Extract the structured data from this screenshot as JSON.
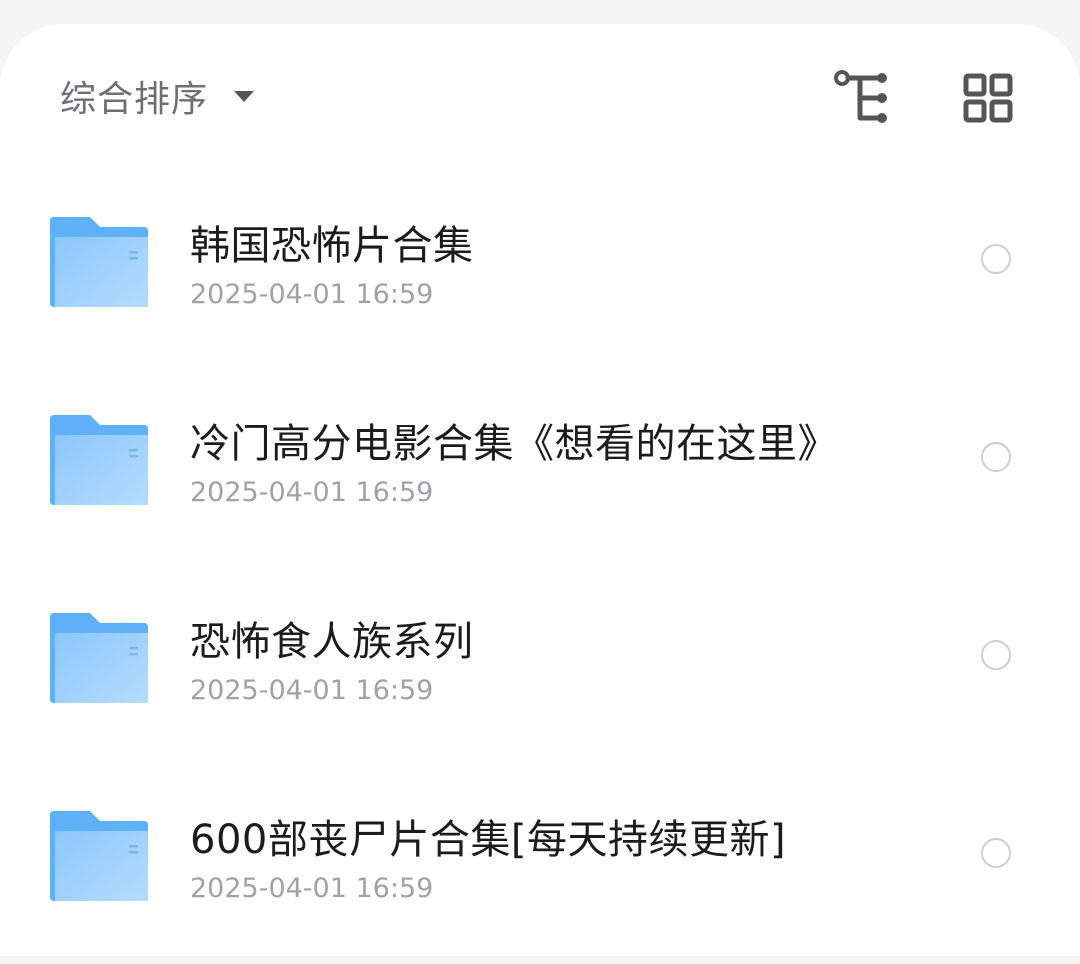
{
  "toolbar": {
    "sort_label": "综合排序",
    "sort_caret_icon": "caret-down-icon",
    "tree_view_icon": "tree-view-icon",
    "grid_view_icon": "grid-view-icon",
    "icon_color": "#555555"
  },
  "files": [
    {
      "name": "韩国恐怖片合集",
      "date": "2025-04-01 16:59",
      "icon": "folder-icon",
      "selected": false
    },
    {
      "name": "冷门高分电影合集《想看的在这里》",
      "date": "2025-04-01 16:59",
      "icon": "folder-icon",
      "selected": false
    },
    {
      "name": "恐怖食人族系列",
      "date": "2025-04-01 16:59",
      "icon": "folder-icon",
      "selected": false
    },
    {
      "name": "600部丧尸片合集[每天持续更新]",
      "date": "2025-04-01 16:59",
      "icon": "folder-icon",
      "selected": false
    }
  ],
  "colors": {
    "folder_back": "#5eb0f7",
    "folder_front_top": "#8cc7fb",
    "folder_front_bottom": "#b5dcfd"
  }
}
